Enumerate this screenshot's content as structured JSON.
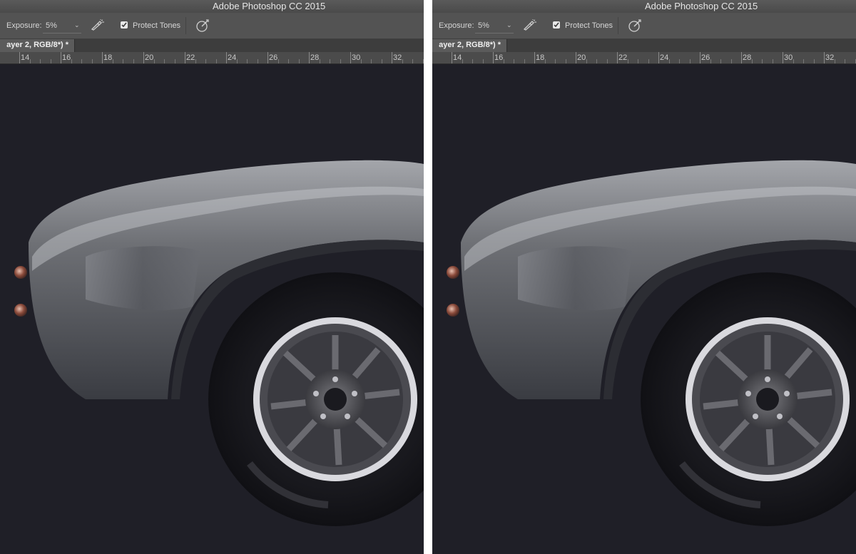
{
  "app": {
    "title": "Adobe Photoshop CC 2015"
  },
  "options_bar": {
    "exposure_label": "Exposure:",
    "exposure_value": "5%",
    "protect_tones_label": "Protect Tones",
    "protect_tones_checked": true,
    "icons": [
      "airbrush-icon",
      "pressure-icon",
      "chevron-down-icon"
    ]
  },
  "document_tab": {
    "label": "ayer 2, RGB/8*) *"
  },
  "ruler": {
    "ticks": [
      "14",
      "16",
      "18",
      "20",
      "22",
      "24",
      "26",
      "28",
      "30",
      "32"
    ]
  },
  "colors": {
    "canvas_background": "#1f1f27",
    "chrome": "#535353",
    "divider": "#ffffff"
  },
  "comparison": {
    "panel_count": 2
  }
}
